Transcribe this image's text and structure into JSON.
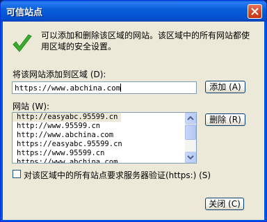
{
  "window": {
    "title": "可信站点"
  },
  "description": "可以添加和删除该区域的网站。该区域中的所有网站都使用区域的安全设置。",
  "add_label": "将该网站添加到区域 (D):",
  "url_input": {
    "value": "https://www.abchina.com"
  },
  "add_button": "添加 (A)",
  "sites_label": "网站 (W):",
  "sites": [
    "http://easyabc.95599.cn",
    "http://www.95599.cn",
    "http://www.abchina.com",
    "https://easyabc.95599.cn",
    "https://www.95599.cn",
    "https://www.abchina.com"
  ],
  "remove_button": "删除 (R)",
  "require_https": {
    "label": "对该区域中的所有站点要求服务器验证(https:) (S)",
    "checked": false
  },
  "close_button": "关闭 (C)",
  "icons": {
    "status": "green-check-icon",
    "close": "close-icon"
  },
  "colors": {
    "titlebar": "#0a5fd9",
    "dialog_bg": "#ece9d8",
    "check": "#3cac2c"
  }
}
